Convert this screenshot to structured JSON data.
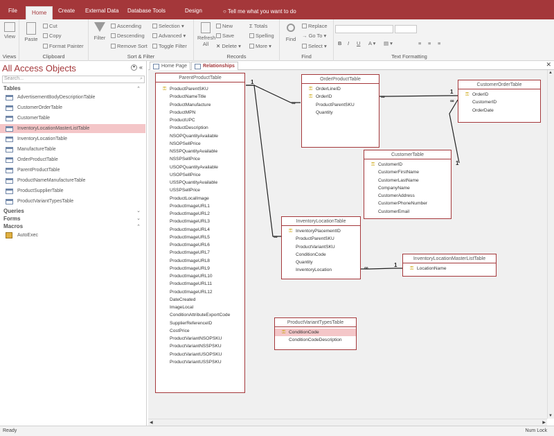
{
  "ribbon": {
    "tabs": [
      "File",
      "Home",
      "Create",
      "External Data",
      "Database Tools",
      "Design"
    ],
    "tell_me": "Tell me what you want to do",
    "views": {
      "view": "View",
      "label": "Views"
    },
    "clipboard": {
      "paste": "Paste",
      "cut": "Cut",
      "copy": "Copy",
      "format_painter": "Format Painter",
      "label": "Clipboard"
    },
    "sort": {
      "filter": "Filter",
      "ascending": "Ascending",
      "descending": "Descending",
      "remove_sort": "Remove Sort",
      "selection": "Selection",
      "advanced": "Advanced",
      "toggle_filter": "Toggle Filter",
      "label": "Sort & Filter"
    },
    "records": {
      "refresh": "Refresh",
      "all": "All",
      "new": "New",
      "save": "Save",
      "delete": "Delete",
      "totals": "Totals",
      "spelling": "Spelling",
      "more": "More",
      "label": "Records"
    },
    "find": {
      "find": "Find",
      "replace": "Replace",
      "goto": "Go To",
      "select": "Select",
      "label": "Find"
    },
    "text_formatting": {
      "bold": "B",
      "italic": "I",
      "underline": "U",
      "label": "Text Formatting"
    }
  },
  "nav": {
    "title": "All Access Objects",
    "search_placeholder": "Search...",
    "sections": {
      "tables": "Tables",
      "queries": "Queries",
      "forms": "Forms",
      "macros": "Macros"
    },
    "tables": [
      "AdvertisementBodyDescriptionTable",
      "CustomerOrderTable",
      "CustomerTable",
      "InventoryLocationMasterListTable",
      "InventoryLocationTable",
      "ManufactureTable",
      "OrderProductTable",
      "ParentProductTable",
      "ProductNameManufactureTable",
      "ProductSupplierTable",
      "ProductVariantTypesTable"
    ],
    "macros": [
      "AutoExec"
    ]
  },
  "doc_tabs": [
    "Home Page",
    "Relationships"
  ],
  "diagram": {
    "parent": {
      "title": "ParentProductTable",
      "fields": [
        "ProductParentSKU",
        "ProductNameTitle",
        "ProductManufacture",
        "ProductMPN",
        "ProductUPC",
        "ProductDescription",
        "NSOPQuantityAvailable",
        "NSOPSellPrice",
        "NSSPQuantityAvailable",
        "NSSPSellPrice",
        "USOPQuantityAvailable",
        "USOPSellPrice",
        "USSPQuantityAvailable",
        "USSPSellPrice",
        "ProductLocalImage",
        "ProductImageURL1",
        "ProductImageURL2",
        "ProductImageURL3",
        "ProductImageURL4",
        "ProductImageURL5",
        "ProductImageURL6",
        "ProductImageURL7",
        "ProductImageURL8",
        "ProductImageURL9",
        "ProductImageURL10",
        "ProductImageURL11",
        "ProductImageURL12",
        "DateCreated",
        "ImageLocal",
        "ConditionAttributeExportCode",
        "SupplierReferenceID",
        "CostPrice",
        "ProductVariantNSOPSKU",
        "ProductVariantNSSPSKU",
        "ProductVariantUSOPSKU",
        "ProductVariantUSSPSKU"
      ]
    },
    "orderproduct": {
      "title": "OrderProductTable",
      "fields": [
        "OrderLineID",
        "OrderID",
        "ProductParentSKU",
        "Quantity"
      ]
    },
    "customerorder": {
      "title": "CustomerOrderTable",
      "fields": [
        "OrderID",
        "CustomerID",
        "OrderDate"
      ]
    },
    "customer": {
      "title": "CustomerTable",
      "fields": [
        "CustomerID",
        "CustomerFirstName",
        "CustomerLastName",
        "CompanyName",
        "CustomerAddress",
        "CustomerPhoneNumber",
        "CustomerEmail"
      ]
    },
    "inventory": {
      "title": "InventoryLocationTable",
      "fields": [
        "InventoryPlacementID",
        "ProductParentSKU",
        "ProductVariantSKU",
        "ConditionCode",
        "Quantity",
        "InventoryLocation"
      ]
    },
    "masterlist": {
      "title": "InventoryLocationMasterListTable",
      "fields": [
        "LocationName"
      ]
    },
    "varianttypes": {
      "title": "ProductVariantTypesTable",
      "fields": [
        "ConditionCode",
        "ConditionCodeDescription"
      ]
    },
    "one": "1",
    "many": "∞"
  },
  "status": {
    "left": "Ready",
    "right": "Num Lock"
  }
}
